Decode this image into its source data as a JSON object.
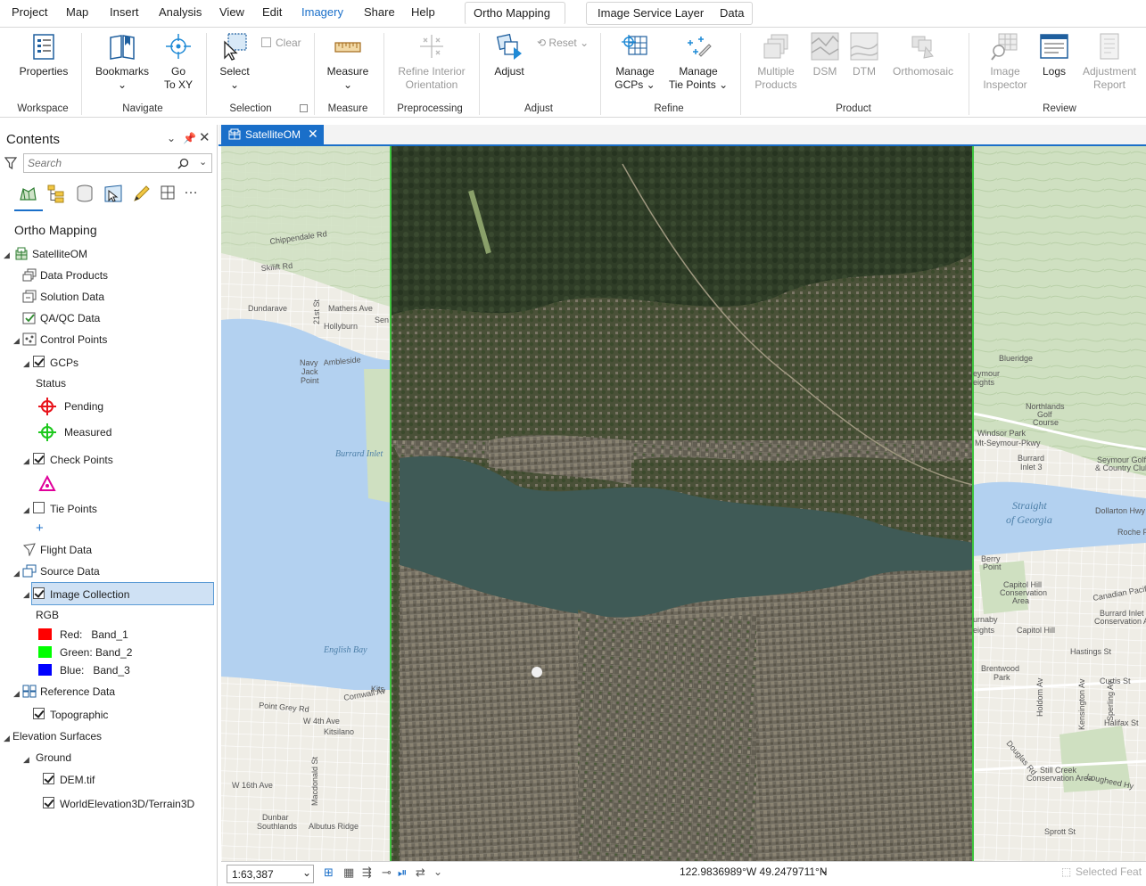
{
  "menubar": {
    "items": [
      "Project",
      "Map",
      "Insert",
      "Analysis",
      "View",
      "Edit",
      "Imagery",
      "Share",
      "Help"
    ],
    "context_tabs": [
      "Ortho Mapping",
      "Image Service Layer",
      "Data"
    ]
  },
  "ribbon": {
    "workspace": {
      "label": "Workspace",
      "properties": "Properties"
    },
    "navigate": {
      "label": "Navigate",
      "bookmarks": "Bookmarks",
      "goto1": "Go",
      "goto2": "To XY"
    },
    "selection": {
      "label": "Selection",
      "select": "Select",
      "clear": "Clear"
    },
    "measure": {
      "label": "Measure",
      "measure": "Measure"
    },
    "preprocessing": {
      "label": "Preprocessing",
      "refine1": "Refine Interior",
      "refine2": "Orientation"
    },
    "adjust": {
      "label": "Adjust",
      "adjust": "Adjust",
      "reset": "Reset"
    },
    "refine": {
      "label": "Refine",
      "gcps1": "Manage",
      "gcps2": "GCPs",
      "tie1": "Manage",
      "tie2": "Tie Points"
    },
    "product": {
      "label": "Product",
      "multi1": "Multiple",
      "multi2": "Products",
      "dsm": "DSM",
      "dtm": "DTM",
      "ortho": "Orthomosaic"
    },
    "review": {
      "label": "Review",
      "insp1": "Image",
      "insp2": "Inspector",
      "logs": "Logs",
      "adj1": "Adjustment",
      "adj2": "Report"
    }
  },
  "contents": {
    "title": "Contents",
    "search_placeholder": "Search",
    "tree": {
      "root": "Ortho Mapping",
      "workspace": "SatelliteOM",
      "data_products": "Data Products",
      "solution_data": "Solution Data",
      "qaqc_data": "QA/QC Data",
      "control_points": "Control Points",
      "gcps": "GCPs",
      "status": "Status",
      "pending": "Pending",
      "measured": "Measured",
      "check_points": "Check Points",
      "tie_points": "Tie Points",
      "flight_data": "Flight Data",
      "source_data": "Source Data",
      "image_collection": "Image Collection",
      "rgb": "RGB",
      "red": "Red:",
      "red_band": "Band_1",
      "green": "Green:",
      "green_band": "Band_2",
      "blue": "Blue:",
      "blue_band": "Band_3",
      "reference_data": "Reference Data",
      "topographic": "Topographic",
      "elevation_surfaces": "Elevation Surfaces",
      "ground": "Ground",
      "dem": "DEM.tif",
      "world_elev": "WorldElevation3D/Terrain3D"
    }
  },
  "map": {
    "tab_title": "SatelliteOM",
    "labels": {
      "chippendale": "Chippendale Rd",
      "skilift": "Skilift Rd",
      "dundarave": "Dundarave",
      "mathers": "Mathers Ave",
      "hollyburn": "Hollyburn",
      "st21": "21st St",
      "ambleside": "Ambleside",
      "navyjack1": "Navy",
      "navyjack2": "Jack",
      "navyjack3": "Point",
      "sen": "Sen",
      "burrard_inlet": "Burrard Inlet",
      "english_bay": "English Bay",
      "kits": "Kits",
      "pointgrey": "Point Grey Rd",
      "cornwall": "Cornwall Av",
      "w4th": "W 4th Ave",
      "kitsilano": "Kitsilano",
      "w16th": "W 16th Ave",
      "macdonald": "Macdonald St",
      "dunbar1": "Dunbar",
      "dunbar2": "Southlands",
      "albutus": "Albutus Ridge",
      "bluer": "Blueridge",
      "seymour1": "eymour",
      "seymour2": "eights",
      "northlands1": "Northlands",
      "northlands2": "Golf",
      "northlands3": "Course",
      "windsor": "Windsor Park",
      "mtseymour": "Mt-Seymour-Pkwy",
      "burrard_inlet3_1": "Burrard",
      "burrard_inlet3_2": "Inlet 3",
      "seymour_golf1": "Seymour Golf",
      "seymour_golf2": "& Country Club",
      "strait1": "Straight",
      "strait2": "of Georgia",
      "dollarton": "Dollarton Hwy",
      "roche": "Roche P",
      "berry1": "Berry",
      "berry2": "Point",
      "capitolhill_cons1": "Capitol Hill",
      "capitolhill_cons2": "Conservation",
      "capitolhill_cons3": "Area",
      "burnaby1": "urnaby",
      "burnaby2": "eights",
      "capitolhill": "Capitol Hill",
      "canadian_pacific": "Canadian Pacific",
      "burrard_cons1": "Burrard Inlet",
      "burrard_cons2": "Conservation Area",
      "hastings": "Hastings St",
      "brentwood1": "Brentwood",
      "brentwood2": "Park",
      "curtis": "Curtis St",
      "halifax": "Halifax St",
      "stillcreek1": "Still Creek",
      "stillcreek2": "Conservation Area",
      "lougheed": "Lougheed Hy",
      "sprott": "Sprott St",
      "kensington": "Kensington Av",
      "holdom": "Holdom Av",
      "sperling": "Sperling Av",
      "douglas": "Douglas Rd"
    }
  },
  "status": {
    "scale": "1:63,387",
    "coords": "122.9836989°W 49.2479711°N",
    "selected": "Selected Feat"
  },
  "colors": {
    "accent": "#1a6fc9",
    "red": "#ff0000",
    "green": "#00ff00",
    "blue": "#0000ff",
    "pending": "#e8141c",
    "measured": "#1ec81e",
    "checkpoint": "#e0009a"
  }
}
